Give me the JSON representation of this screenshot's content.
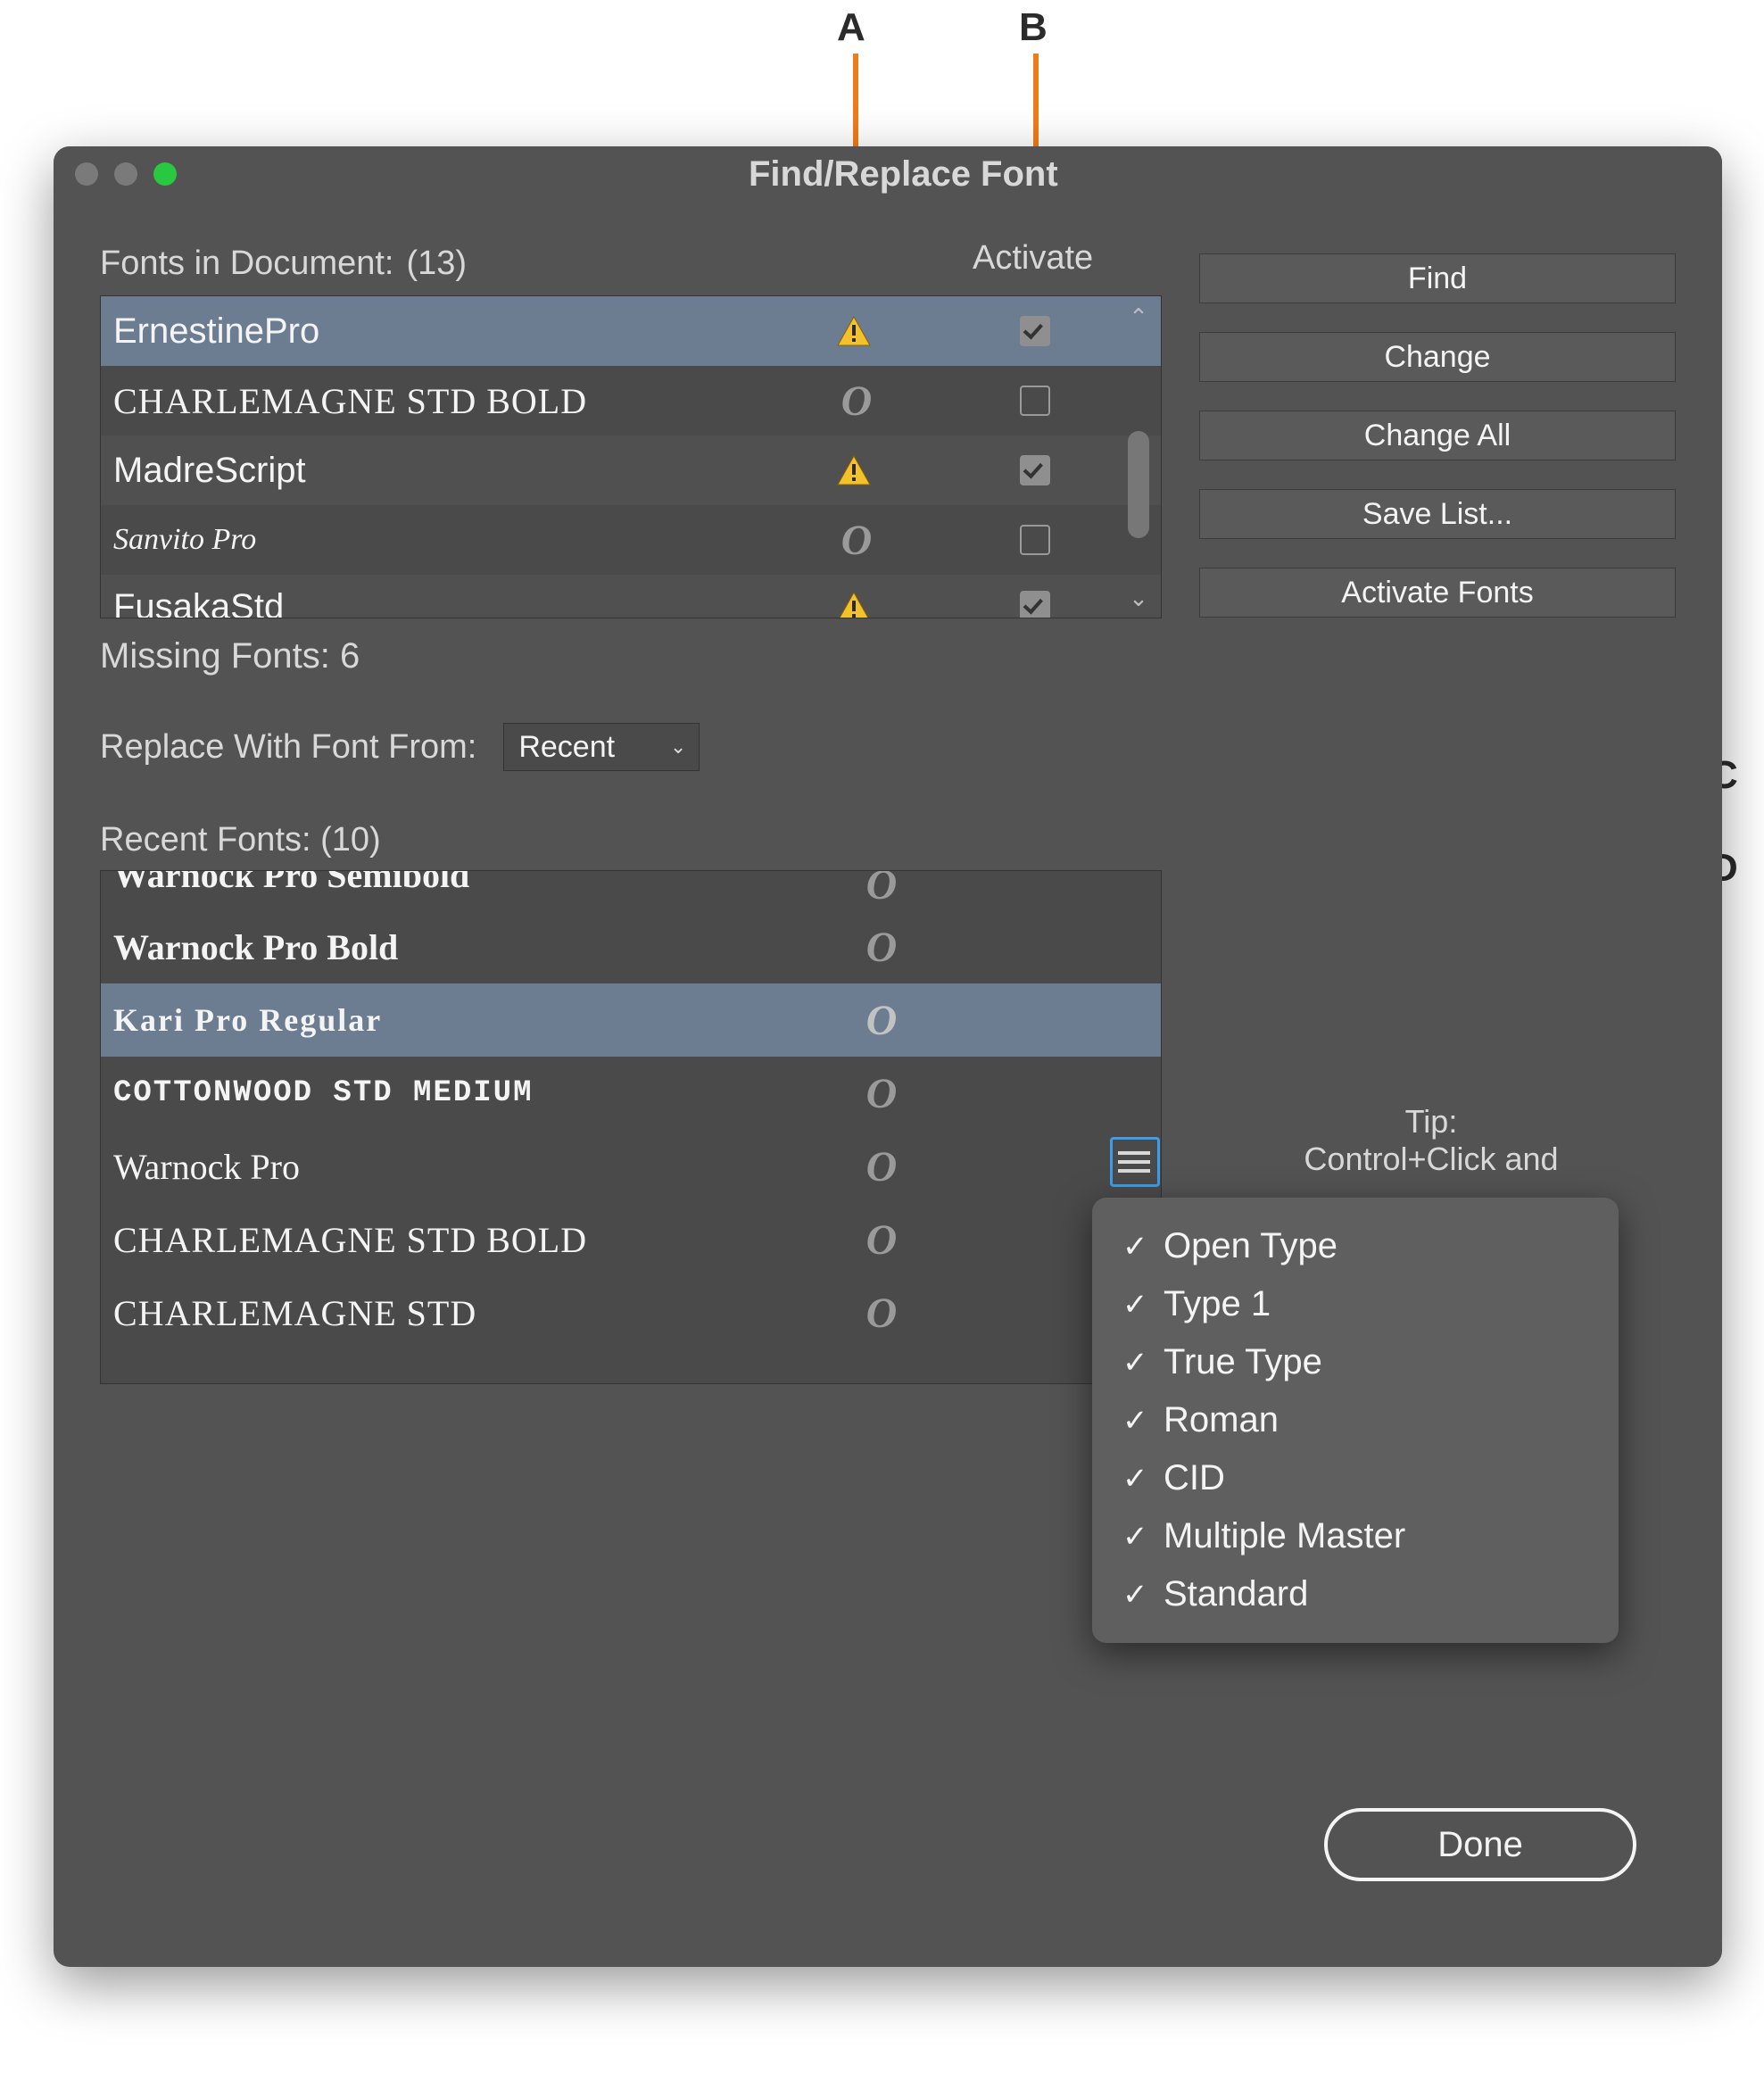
{
  "window": {
    "title": "Find/Replace Font"
  },
  "header": {
    "fonts_in_doc_label": "Fonts in Document:",
    "fonts_in_doc_count": "(13)",
    "activate_label": "Activate"
  },
  "doc_fonts": [
    {
      "name": "ErnestinePro",
      "style": "",
      "missing": true,
      "activate_checked": true,
      "selected": true
    },
    {
      "name": "CHARLEMAGNE STD BOLD",
      "style": "serifcaps",
      "missing": false,
      "activate_checked": false,
      "selected": false
    },
    {
      "name": "MadreScript",
      "style": "",
      "missing": true,
      "activate_checked": true,
      "selected": false
    },
    {
      "name": "Sanvito Pro",
      "style": "italicserif",
      "missing": false,
      "activate_checked": false,
      "selected": false
    },
    {
      "name": "FusakaStd",
      "style": "",
      "missing": true,
      "activate_checked": true,
      "selected": false
    }
  ],
  "missing_fonts_label": "Missing Fonts: 6",
  "replace_label": "Replace With Font From:",
  "replace_source": "Recent",
  "recent_fonts_label": "Recent Fonts:",
  "recent_fonts_count": "(10)",
  "recent_fonts": [
    {
      "name": "Warnock Pro Semibold",
      "style": "boldserif cutoff",
      "selected": false
    },
    {
      "name": "Warnock Pro Bold",
      "style": "boldserif",
      "selected": false
    },
    {
      "name": "Kari Pro Regular",
      "style": "displaydeco",
      "selected": true
    },
    {
      "name": "COTTONWOOD STD MEDIUM",
      "style": "slab",
      "selected": false
    },
    {
      "name": "Warnock Pro",
      "style": "serif",
      "selected": false
    },
    {
      "name": "CHARLEMAGNE STD BOLD",
      "style": "serifcaps",
      "selected": false
    },
    {
      "name": "CHARLEMAGNE STD",
      "style": "serifcaps",
      "selected": false
    }
  ],
  "buttons": {
    "find": "Find",
    "change": "Change",
    "change_all": "Change All",
    "save_list": "Save List...",
    "activate_fonts": "Activate Fonts",
    "done": "Done"
  },
  "tip": {
    "line1": "Tip:",
    "line2": "Control+Click and"
  },
  "popup": {
    "items": [
      "Open Type",
      "Type 1",
      "True Type",
      "Roman",
      "CID",
      "Multiple Master",
      "Standard"
    ]
  },
  "callouts": {
    "A": "A",
    "B": "B",
    "C": "C",
    "D": "D"
  }
}
